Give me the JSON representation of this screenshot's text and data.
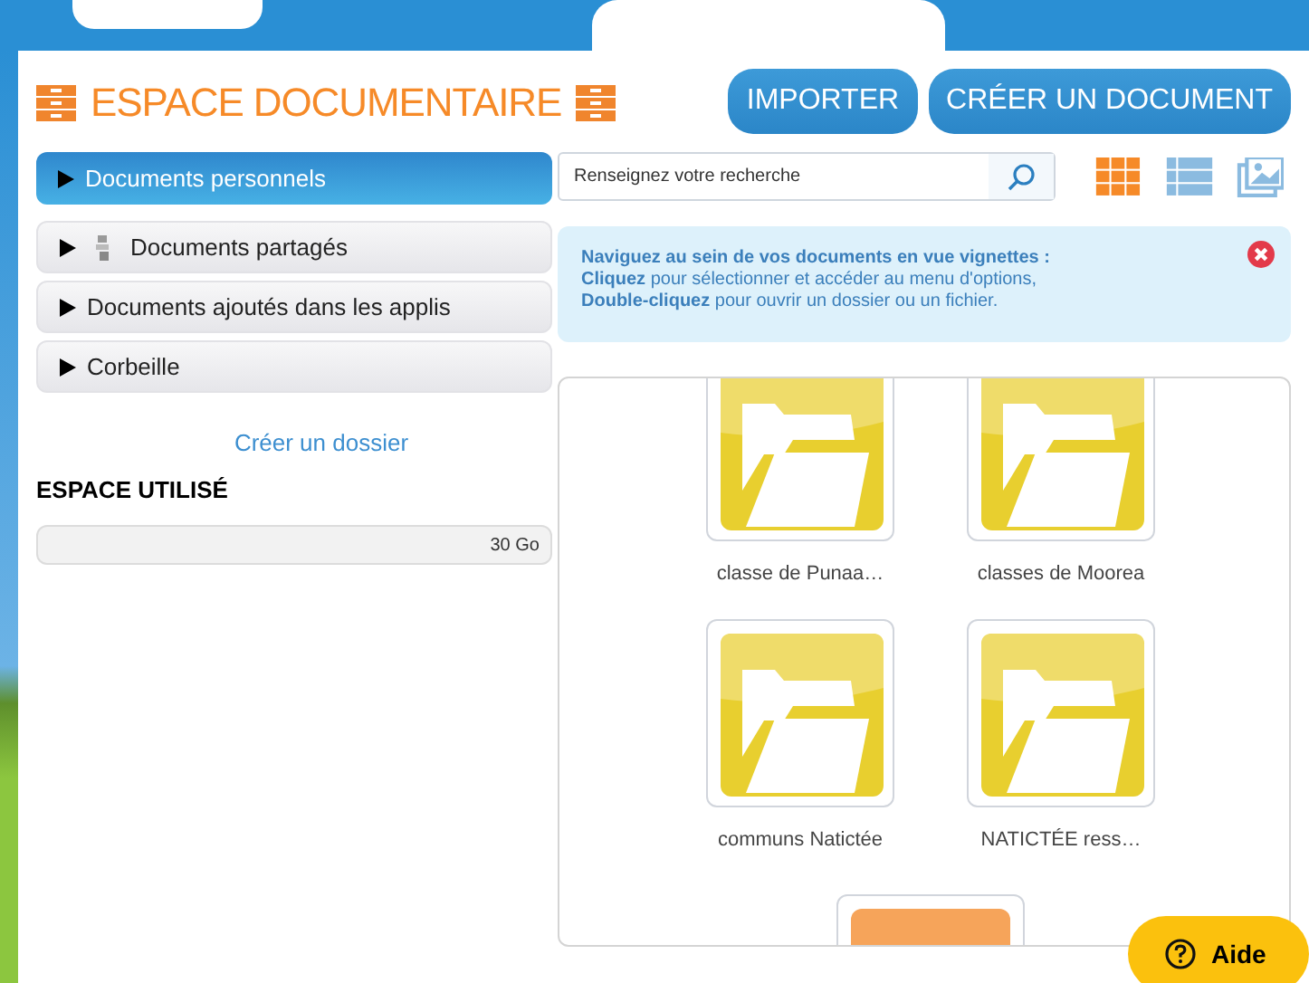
{
  "header": {
    "title": "ESPACE DOCUMENTAIRE",
    "buttons": [
      {
        "label": "IMPORTER"
      },
      {
        "label": "CRÉER UN DOCUMENT"
      }
    ]
  },
  "sidebar": {
    "items": [
      {
        "label": "Documents personnels",
        "selected": true,
        "kind": "plain"
      },
      {
        "label": "Documents partagés",
        "selected": false,
        "kind": "shared"
      },
      {
        "label": "Documents ajoutés dans les applis",
        "selected": false,
        "kind": "plain"
      },
      {
        "label": "Corbeille",
        "selected": false,
        "kind": "plain"
      }
    ],
    "create_folder_link": "Créer un dossier",
    "storage": {
      "heading": "ESPACE UTILISÉ",
      "reading": "30 Go"
    }
  },
  "search": {
    "placeholder": "Renseignez votre recherche"
  },
  "views": [
    {
      "kind": "grid",
      "selected": true
    },
    {
      "kind": "list",
      "selected": false
    },
    {
      "kind": "gallery",
      "selected": false
    }
  ],
  "info": {
    "lines": [
      "**Naviguez au sein de vos documents en vue vignettes :**",
      "**Cliquez** pour sélectionner et accéder au menu d'options,",
      "**Double-cliquez** pour ouvrir un dossier ou un fichier."
    ]
  },
  "folders": [
    {
      "name": "classe de Punaa…"
    },
    {
      "name": "classes de Moorea"
    },
    {
      "name": "communs Natictée"
    },
    {
      "name": "NATICTÉE ress…"
    }
  ],
  "help_button": {
    "label": "Aide"
  }
}
